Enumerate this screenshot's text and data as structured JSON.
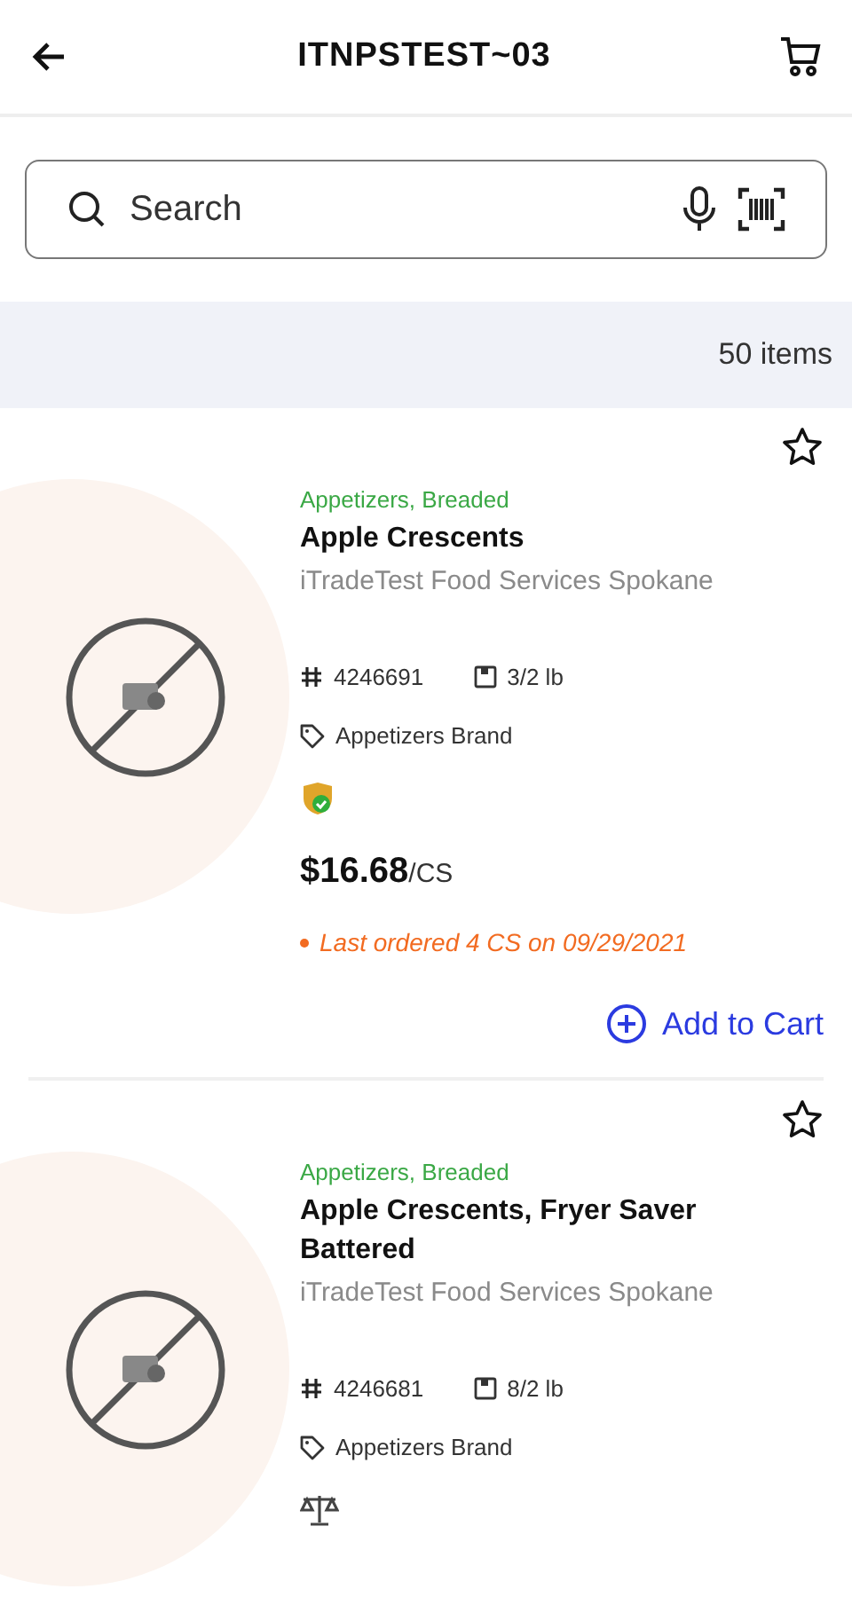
{
  "header": {
    "title": "ITNPSTEST~03"
  },
  "search": {
    "placeholder": "Search"
  },
  "results": {
    "count": "50 items"
  },
  "products": [
    {
      "favorite": false,
      "category": "Appetizers, Breaded",
      "name": "Apple Crescents",
      "supplier": "iTradeTest Food Services Spokane",
      "item_number": "4246691",
      "pack": "3/2 lb",
      "brand": "Appetizers Brand",
      "badge": {
        "kind": "shield"
      },
      "price": "$16.68",
      "unit": "/CS",
      "last_ordered": "Last ordered 4 CS on 09/29/2021",
      "action": "Add to Cart"
    },
    {
      "favorite": false,
      "category": "Appetizers, Breaded",
      "name": "Apple Crescents, Fryer Saver Battered",
      "supplier": "iTradeTest Food Services Spokane",
      "item_number": "4246681",
      "pack": "8/2 lb",
      "brand": "Appetizers Brand",
      "badge": {
        "kind": "scale"
      }
    }
  ]
}
